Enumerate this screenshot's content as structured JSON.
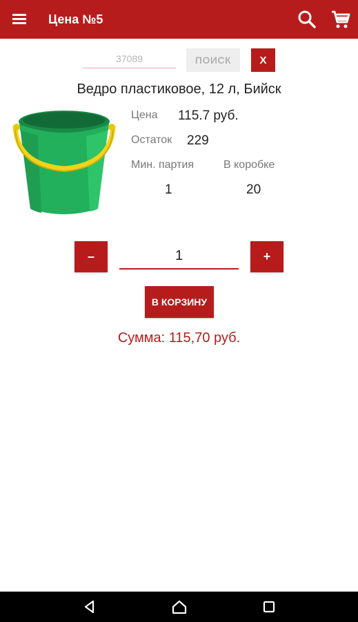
{
  "appbar": {
    "title": "Цена №5",
    "menu_icon": "hamburger-menu-icon",
    "search_icon": "search-icon",
    "cart_icon": "shopping-cart-icon",
    "color": "#b71c1c"
  },
  "search": {
    "placeholder": "37089",
    "button_label": "ПОИСК",
    "clear_label": "X"
  },
  "product": {
    "title": "Ведро пластиковое, 12 л, Бийск",
    "image": "green-bucket-with-yellow-handle",
    "price_label": "Цена",
    "price_value": "115.7 руб.",
    "stock_label": "Остаток",
    "stock_value": "229",
    "min_batch_label": "Мин. партия",
    "min_batch_value": "1",
    "per_box_label": "В коробке",
    "per_box_value": "20"
  },
  "quantity": {
    "minus_label": "–",
    "value": "1",
    "plus_label": "+"
  },
  "cart": {
    "add_button_label": "В КОРЗИНУ",
    "total_text": "Сумма: 115,70 руб."
  },
  "navbar": {
    "back_icon": "back-triangle-icon",
    "home_icon": "home-icon",
    "recents_icon": "recents-square-icon"
  }
}
